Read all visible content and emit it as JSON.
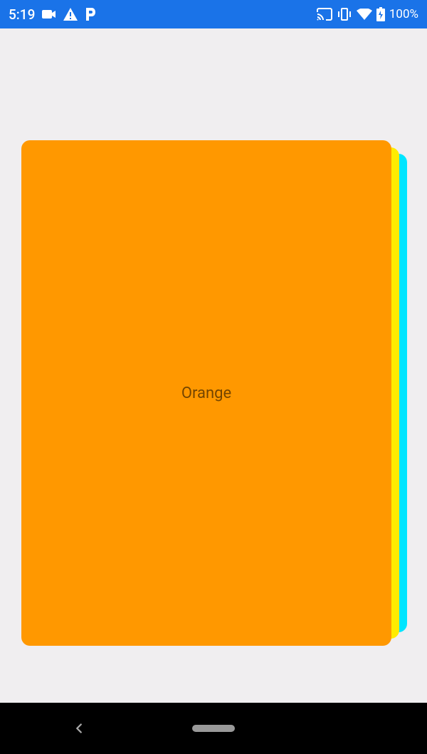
{
  "statusBar": {
    "time": "5:19",
    "battery": "100%"
  },
  "cards": {
    "front": {
      "label": "Orange",
      "color": "#ff9800"
    },
    "back1": {
      "color": "#ffeb00"
    },
    "back2": {
      "color": "#00e5ff"
    }
  }
}
